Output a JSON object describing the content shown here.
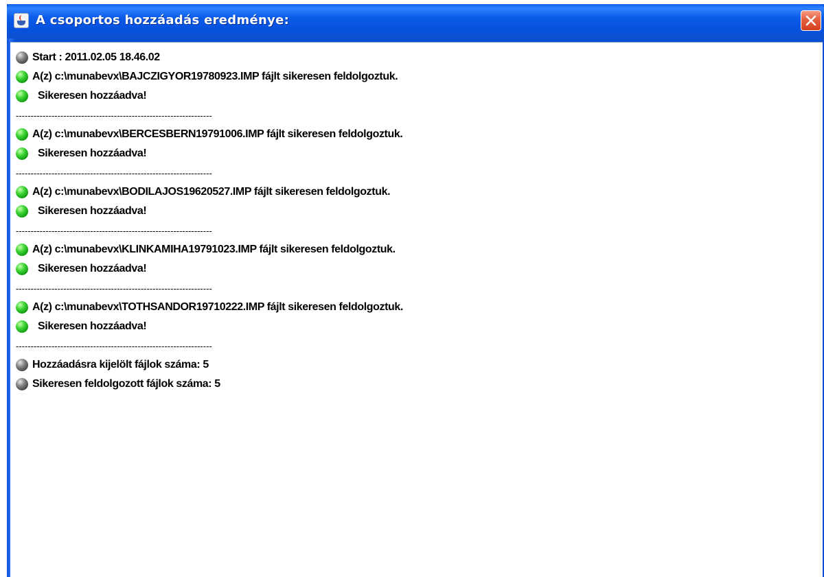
{
  "window": {
    "title": "A csoportos hozzáadás eredménye:",
    "icon": "java-cup-icon",
    "close_icon": "close-x-icon",
    "accent_color": "#0a5ae8",
    "close_color": "#e5603f"
  },
  "log": [
    {
      "type": "line",
      "status": "gray",
      "text": "Start : 2011.02.05 18.46.02",
      "indent": false
    },
    {
      "type": "line",
      "status": "green",
      "text": "A(z) c:\\munabevx\\BAJCZIGYOR19780923.IMP fájlt sikeresen feldolgoztuk.",
      "indent": false
    },
    {
      "type": "line",
      "status": "green",
      "text": "Sikeresen hozzáadva!",
      "indent": true
    },
    {
      "type": "separator",
      "text": "------------------------------------------------------------------"
    },
    {
      "type": "line",
      "status": "green",
      "text": "A(z) c:\\munabevx\\BERCESBERN19791006.IMP fájlt sikeresen feldolgoztuk.",
      "indent": false
    },
    {
      "type": "line",
      "status": "green",
      "text": "Sikeresen hozzáadva!",
      "indent": true
    },
    {
      "type": "separator",
      "text": "------------------------------------------------------------------"
    },
    {
      "type": "line",
      "status": "green",
      "text": "A(z) c:\\munabevx\\BODILAJOS19620527.IMP fájlt sikeresen feldolgoztuk.",
      "indent": false
    },
    {
      "type": "line",
      "status": "green",
      "text": "Sikeresen hozzáadva!",
      "indent": true
    },
    {
      "type": "separator",
      "text": "------------------------------------------------------------------"
    },
    {
      "type": "line",
      "status": "green",
      "text": "A(z) c:\\munabevx\\KLINKAMIHA19791023.IMP fájlt sikeresen feldolgoztuk.",
      "indent": false
    },
    {
      "type": "line",
      "status": "green",
      "text": "Sikeresen hozzáadva!",
      "indent": true
    },
    {
      "type": "separator",
      "text": "------------------------------------------------------------------"
    },
    {
      "type": "line",
      "status": "green",
      "text": "A(z) c:\\munabevx\\TOTHSANDOR19710222.IMP fájlt sikeresen feldolgoztuk.",
      "indent": false
    },
    {
      "type": "line",
      "status": "green",
      "text": "Sikeresen hozzáadva!",
      "indent": true
    },
    {
      "type": "separator",
      "text": "------------------------------------------------------------------"
    },
    {
      "type": "line",
      "status": "gray",
      "text": "Hozzáadásra kijelölt fájlok száma: 5",
      "indent": false
    },
    {
      "type": "line",
      "status": "gray",
      "text": "Sikeresen feldolgozott fájlok száma: 5",
      "indent": false
    }
  ]
}
